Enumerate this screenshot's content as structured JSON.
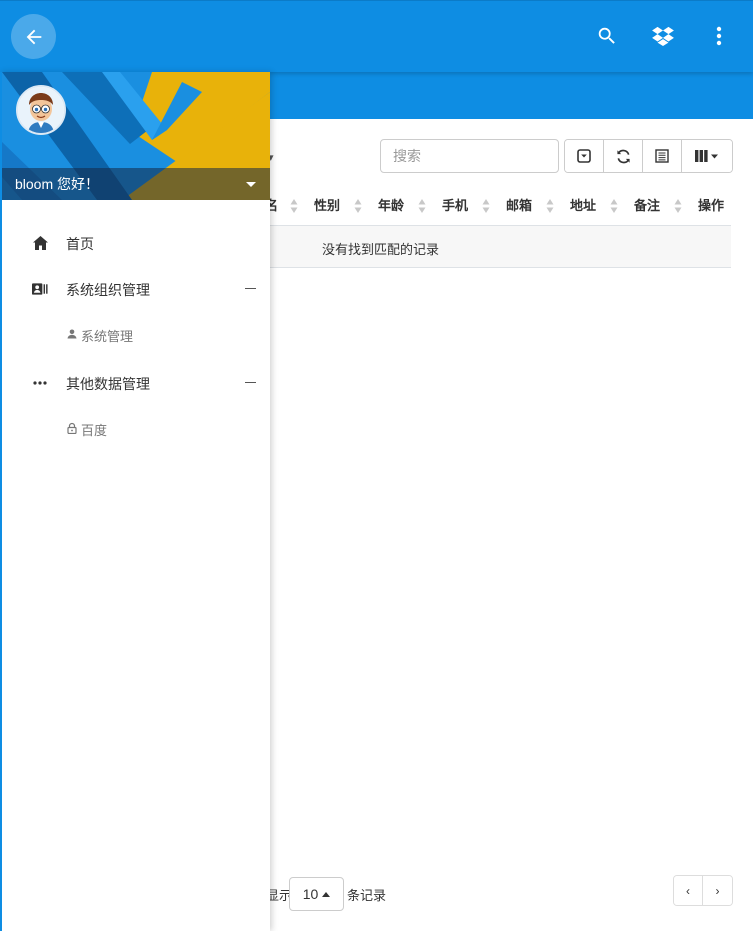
{
  "header": {
    "back_icon": "arrow-left-icon",
    "actions": [
      {
        "name": "search-icon"
      },
      {
        "name": "dropbox-icon"
      },
      {
        "name": "more-vertical-icon"
      }
    ]
  },
  "toolbar": {
    "search_placeholder": "搜索",
    "buttons": [
      "toggle-icon",
      "refresh-icon",
      "export-icon",
      "columns-icon"
    ]
  },
  "table": {
    "partial_first_header": "名",
    "columns": [
      "性别",
      "年龄",
      "手机",
      "邮箱",
      "地址",
      "备注",
      "操作"
    ],
    "empty_text": "没有找到匹配的记录"
  },
  "pagination": {
    "prefix": "显示",
    "page_size": "10",
    "suffix": "条记录",
    "prev": "‹",
    "next": "›"
  },
  "drawer": {
    "greeting": "bloom 您好！",
    "menu": [
      {
        "label": "首页",
        "icon": "home-icon"
      },
      {
        "label": "系统组织管理",
        "icon": "contacts-icon",
        "children": [
          {
            "label": "系统管理",
            "icon": "person-icon"
          }
        ]
      },
      {
        "label": "其他数据管理",
        "icon": "more-horizontal-icon",
        "children": [
          {
            "label": "百度",
            "icon": "lock-icon"
          }
        ]
      }
    ]
  },
  "colors": {
    "primary": "#0e8de3",
    "accent_yellow": "#e8b20a"
  }
}
